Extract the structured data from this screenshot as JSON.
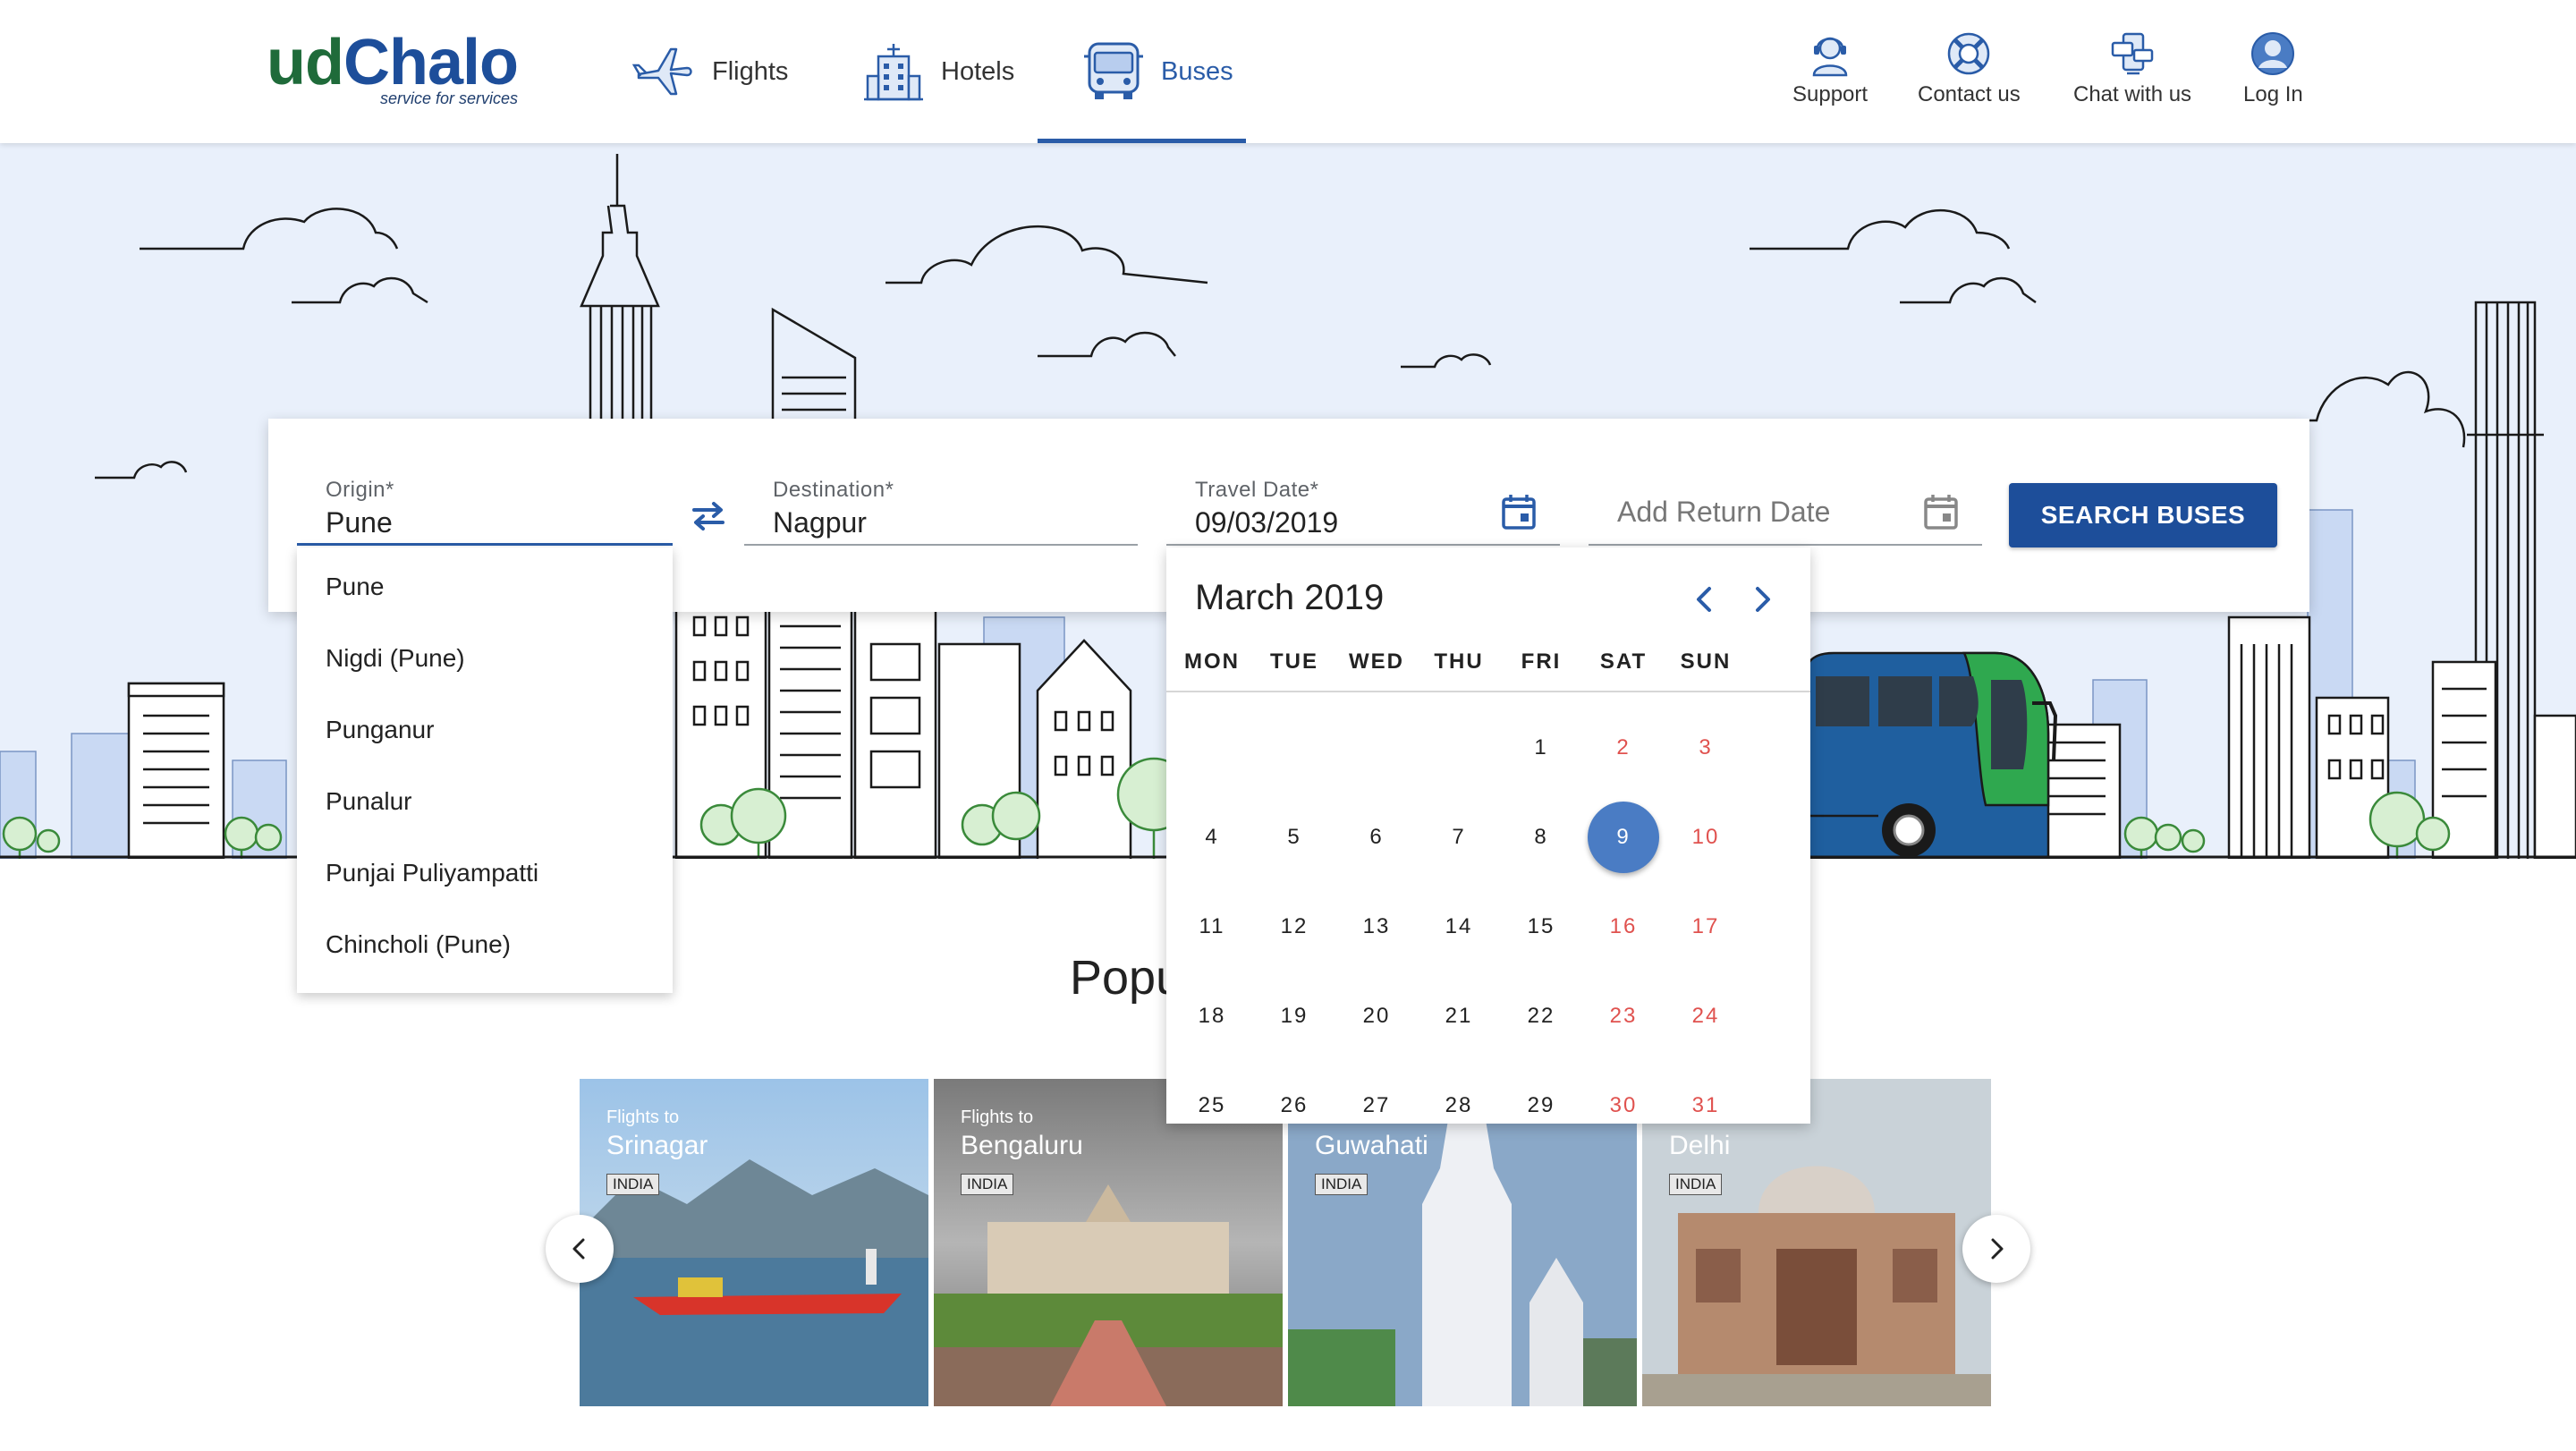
{
  "brand": {
    "name_part1": "ud",
    "name_part2": "Chalo",
    "tagline": "service for services",
    "colors": {
      "green": "#1f6b3a",
      "blue": "#1d4e9a",
      "accent": "#2a5ca8",
      "weekend": "#e0524f"
    }
  },
  "nav": [
    {
      "label": "Flights",
      "icon": "airplane-icon",
      "active": false
    },
    {
      "label": "Hotels",
      "icon": "hotel-icon",
      "active": false
    },
    {
      "label": "Buses",
      "icon": "bus-icon",
      "active": true
    }
  ],
  "utility": [
    {
      "label": "Support",
      "icon": "support-agent-icon"
    },
    {
      "label": "Contact us",
      "icon": "lifebuoy-icon"
    },
    {
      "label": "Chat with us",
      "icon": "chat-icon"
    },
    {
      "label": "Log In",
      "icon": "user-icon"
    }
  ],
  "search": {
    "origin": {
      "label": "Origin*",
      "value": "Pune"
    },
    "destination": {
      "label": "Destination*",
      "value": "Nagpur"
    },
    "travel_date": {
      "label": "Travel Date*",
      "value": "09/03/2019"
    },
    "return_date": {
      "placeholder": "Add Return Date"
    },
    "button_label": "SEARCH BUSES"
  },
  "origin_suggestions": [
    "Pune",
    "Nigdi (Pune)",
    "Punganur",
    "Punalur",
    "Punjai Puliyampatti",
    "Chincholi (Pune)"
  ],
  "calendar": {
    "month_label": "March 2019",
    "weekdays": [
      "MON",
      "TUE",
      "WED",
      "THU",
      "FRI",
      "SAT",
      "SUN"
    ],
    "days_in_month": 31,
    "first_weekday_index": 4,
    "selected_day": 9
  },
  "popular": {
    "title": "Popu",
    "cards": [
      {
        "small": "Flights to",
        "city": "Srinagar",
        "badge": "INDIA"
      },
      {
        "small": "Flights to",
        "city": "Bengaluru",
        "badge": "INDIA"
      },
      {
        "small": "",
        "city": "Guwahati",
        "badge": "INDIA"
      },
      {
        "small": "",
        "city": "Delhi",
        "badge": "INDIA"
      }
    ]
  }
}
